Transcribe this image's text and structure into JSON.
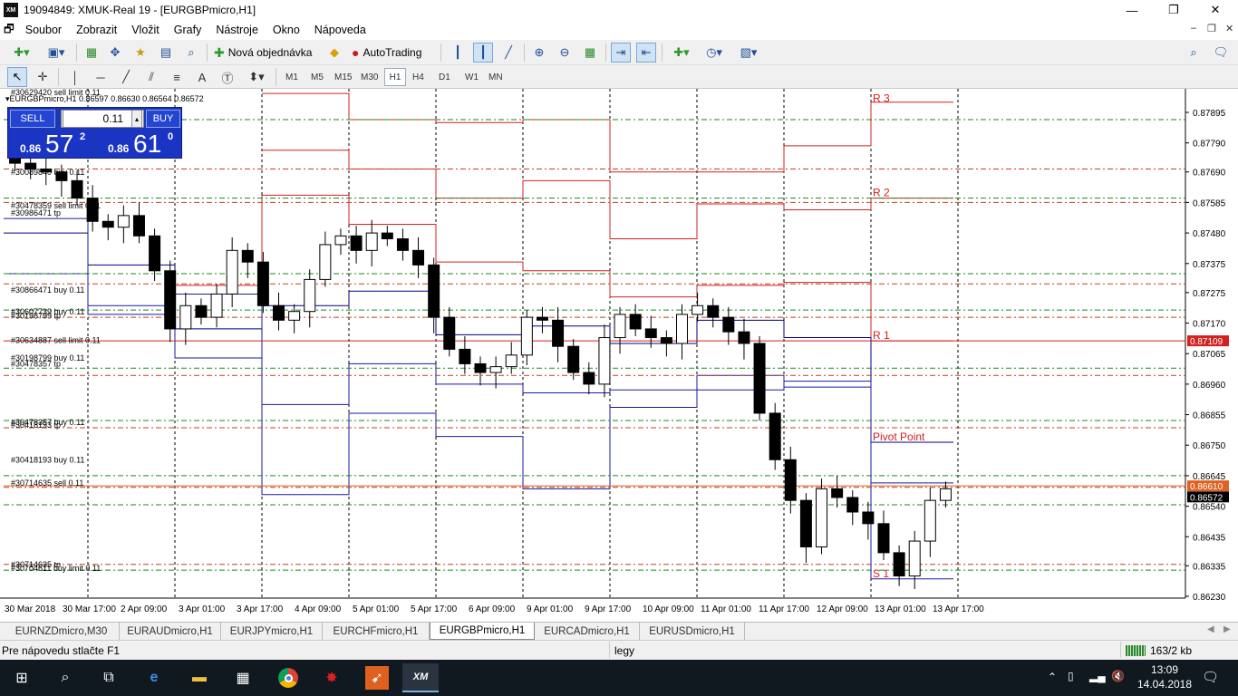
{
  "window": {
    "title": "19094849: XMUK-Real 19 - [EURGBPmicro,H1]",
    "logo": "XM",
    "controls": [
      "minimize-icon",
      "maximize-icon",
      "close-icon"
    ]
  },
  "menu": {
    "items": [
      "Soubor",
      "Zobrazit",
      "Vložit",
      "Grafy",
      "Nástroje",
      "Okno",
      "Nápoveda"
    ]
  },
  "toolbar": {
    "new_order": "Nová objednávka",
    "autotrading": "AutoTrading"
  },
  "timeframes": [
    "M1",
    "M5",
    "M15",
    "M30",
    "H1",
    "H4",
    "D1",
    "W1",
    "MN"
  ],
  "active_timeframe": "H1",
  "chart": {
    "header": "▾EURGBPmicro,H1 0.86597 0.86630 0.86564 0.86572",
    "header_partial": "#30629420 sell limit 0.11",
    "one_click": {
      "sell_label": "SELL",
      "buy_label": "BUY",
      "lot": "0.11",
      "sell_prefix": "0.86",
      "sell_big": "57",
      "sell_sup": "2",
      "buy_prefix": "0.86",
      "buy_big": "61",
      "buy_sup": "0"
    },
    "price_ticks": [
      "0.87895",
      "0.87790",
      "0.87690",
      "0.87585",
      "0.87480",
      "0.87375",
      "0.87275",
      "0.87170",
      "0.87065",
      "0.86960",
      "0.86855",
      "0.86750",
      "0.86645",
      "0.86540",
      "0.86435",
      "0.86335",
      "0.86230"
    ],
    "price_markers": [
      {
        "value": "0.87109",
        "color": "#d42020"
      },
      {
        "value": "0.86610",
        "color": "#e06020"
      },
      {
        "value": "0.86572",
        "color": "#000000"
      }
    ],
    "time_ticks": [
      "30 Mar 2018",
      "30 Mar 17:00",
      "2 Apr 09:00",
      "3 Apr 01:00",
      "3 Apr 17:00",
      "4 Apr 09:00",
      "5 Apr 01:00",
      "5 Apr 17:00",
      "6 Apr 09:00",
      "9 Apr 01:00",
      "9 Apr 17:00",
      "10 Apr 09:00",
      "11 Apr 01:00",
      "11 Apr 17:00",
      "12 Apr 09:00",
      "13 Apr 01:00",
      "13 Apr 17:00"
    ],
    "pivot_labels": [
      "R 3",
      "R 2",
      "R 1",
      "Pivot Point",
      "S 1"
    ],
    "order_labels": [
      "#30089840 buy 0.11",
      "#30478359 sell limit 0.11",
      "#30986471 tp",
      "#30866471 buy 0.11",
      "#30607739 buy 0.11",
      "#30198799 tp",
      "#30634887 sell limit 0.11",
      "#30198799 buy 0.11",
      "#30478357 tp",
      "#30478357 buy 0.11",
      "#30418193 tp",
      "#30418193 buy 0.11",
      "#30714635 sell 0.11",
      "#30714635 tp",
      "#30704611 buy limit 0.11"
    ],
    "colors": {
      "bull": "#000000",
      "resistance": "#d42020",
      "support": "#1a1aa0",
      "order_green": "#1a8a1a",
      "order_red": "#c04020"
    }
  },
  "tabs": [
    "EURNZDmicro,M30",
    "EURAUDmicro,H1",
    "EURJPYmicro,H1",
    "EURCHFmicro,H1",
    "EURGBPmicro,H1",
    "EURCADmicro,H1",
    "EURUSDmicro,H1"
  ],
  "active_tab": "EURGBPmicro,H1",
  "status": {
    "help": "Pre nápovedu stlačte F1",
    "profile": "legy",
    "traffic": "163/2 kb"
  },
  "taskbar": {
    "time": "13:09",
    "date": "14.04.2018",
    "apps": [
      "windows-start-icon",
      "search-icon",
      "task-view-icon",
      "edge-icon",
      "file-explorer-icon",
      "store-icon",
      "chrome-icon",
      "game-icon",
      "app-icon",
      "xm-icon"
    ]
  }
}
